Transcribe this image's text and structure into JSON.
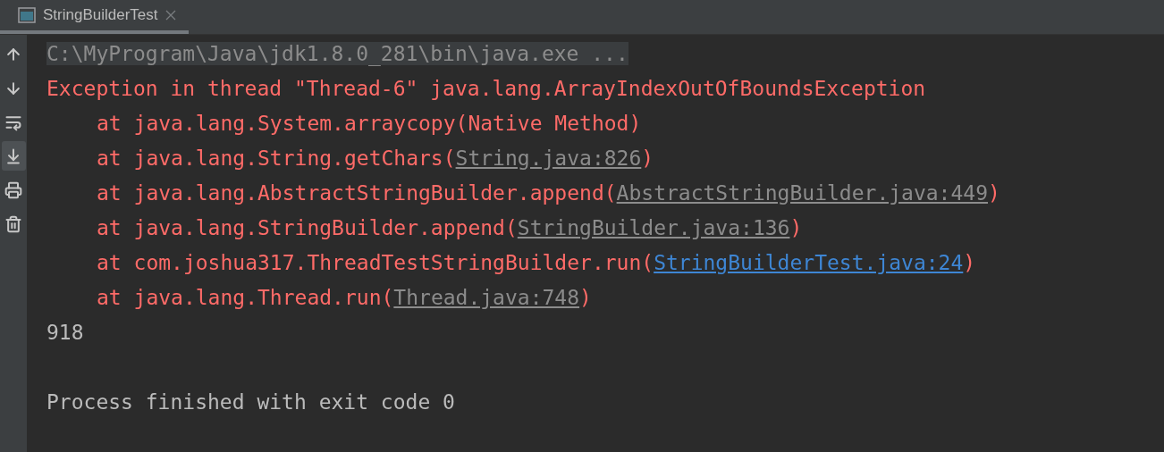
{
  "tabs": [
    {
      "label": "StringBuilderTest",
      "selected": true
    }
  ],
  "toolbar": [
    {
      "kind": "up",
      "selected": false
    },
    {
      "kind": "down",
      "selected": false
    },
    {
      "kind": "wrap",
      "selected": false
    },
    {
      "kind": "scroll-end",
      "selected": true
    },
    {
      "kind": "print",
      "selected": false
    },
    {
      "kind": "clear",
      "selected": false
    }
  ],
  "console": [
    {
      "kind": "command",
      "parts": [
        {
          "kind": "text",
          "text": "C:\\MyProgram\\Java\\jdk1.8.0_281\\bin\\java.exe ..."
        }
      ]
    },
    {
      "kind": "error",
      "parts": [
        {
          "kind": "text",
          "text": "Exception in thread \"Thread-6\" java.lang.ArrayIndexOutOfBoundsException"
        }
      ]
    },
    {
      "kind": "trace",
      "parts": [
        {
          "kind": "text",
          "text": "at java.lang.System.arraycopy(Native Method)"
        }
      ]
    },
    {
      "kind": "trace",
      "parts": [
        {
          "kind": "text",
          "text": "at java.lang.String.getChars("
        },
        {
          "kind": "link",
          "text": "String.java:826"
        },
        {
          "kind": "text",
          "text": ")"
        }
      ]
    },
    {
      "kind": "trace",
      "parts": [
        {
          "kind": "text",
          "text": "at java.lang.AbstractStringBuilder.append("
        },
        {
          "kind": "link",
          "text": "AbstractStringBuilder.java:449"
        },
        {
          "kind": "text",
          "text": ")"
        }
      ]
    },
    {
      "kind": "trace",
      "parts": [
        {
          "kind": "text",
          "text": "at java.lang.StringBuilder.append("
        },
        {
          "kind": "link",
          "text": "StringBuilder.java:136"
        },
        {
          "kind": "text",
          "text": ")"
        }
      ]
    },
    {
      "kind": "trace",
      "parts": [
        {
          "kind": "text",
          "text": "at com.joshua317.ThreadTestStringBuilder.run("
        },
        {
          "kind": "project-link",
          "text": "StringBuilderTest.java:24"
        },
        {
          "kind": "text",
          "text": ")"
        }
      ]
    },
    {
      "kind": "trace",
      "parts": [
        {
          "kind": "text",
          "text": "at java.lang.Thread.run("
        },
        {
          "kind": "link",
          "text": "Thread.java:748"
        },
        {
          "kind": "text",
          "text": ")"
        }
      ]
    },
    {
      "kind": "output",
      "parts": [
        {
          "kind": "text",
          "text": "918"
        }
      ]
    },
    {
      "kind": "gap"
    },
    {
      "kind": "output",
      "parts": [
        {
          "kind": "text",
          "text": "Process finished with exit code 0"
        }
      ]
    }
  ]
}
